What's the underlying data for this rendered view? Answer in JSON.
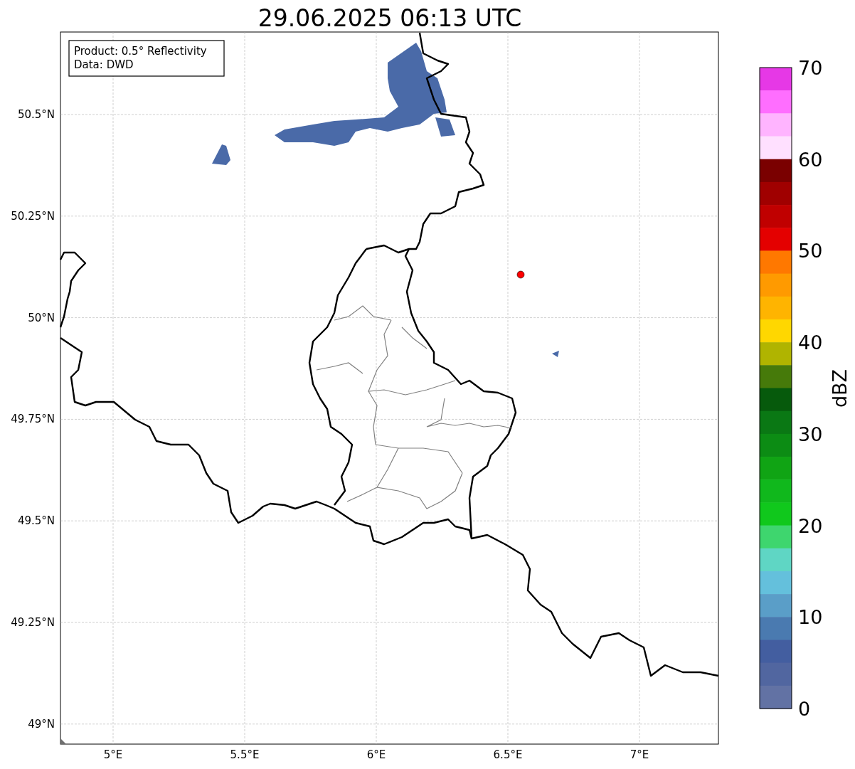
{
  "title": "29.06.2025 06:13 UTC",
  "legend": [
    "Product: 0.5° Reflectivity",
    "Data: DWD"
  ],
  "map": {
    "xtick_labels": [
      "5°E",
      "5.5°E",
      "6°E",
      "6.5°E",
      "7°E"
    ],
    "ytick_labels": [
      "50.5°N",
      "50.25°N",
      "50°N",
      "49.75°N",
      "49.5°N",
      "49.25°N",
      "49°N"
    ],
    "marker": {
      "color": "#ff0000"
    }
  },
  "colorbar": {
    "label": "dBZ",
    "tick_labels": [
      "70",
      "60",
      "50",
      "40",
      "30",
      "20",
      "10",
      "0"
    ],
    "segments": [
      {
        "color": "#e638e6"
      },
      {
        "color": "#ff6eff"
      },
      {
        "color": "#ffb4ff"
      },
      {
        "color": "#ffe0ff"
      },
      {
        "color": "#7a0000"
      },
      {
        "color": "#a00000"
      },
      {
        "color": "#c00000"
      },
      {
        "color": "#e40000"
      },
      {
        "color": "#ff7800"
      },
      {
        "color": "#ff9a00"
      },
      {
        "color": "#ffb400"
      },
      {
        "color": "#ffd700"
      },
      {
        "color": "#b0b400"
      },
      {
        "color": "#467a0a"
      },
      {
        "color": "#065a0c"
      },
      {
        "color": "#0a7814"
      },
      {
        "color": "#0c8c14"
      },
      {
        "color": "#10a414"
      },
      {
        "color": "#10b81c"
      },
      {
        "color": "#10c81c"
      },
      {
        "color": "#3ed66e"
      },
      {
        "color": "#5fd6c4"
      },
      {
        "color": "#64c0dc"
      },
      {
        "color": "#5a9ec8"
      },
      {
        "color": "#4a7ab0"
      },
      {
        "color": "#435ea0"
      },
      {
        "color": "#5166a0"
      },
      {
        "color": "#6272a4"
      }
    ]
  }
}
